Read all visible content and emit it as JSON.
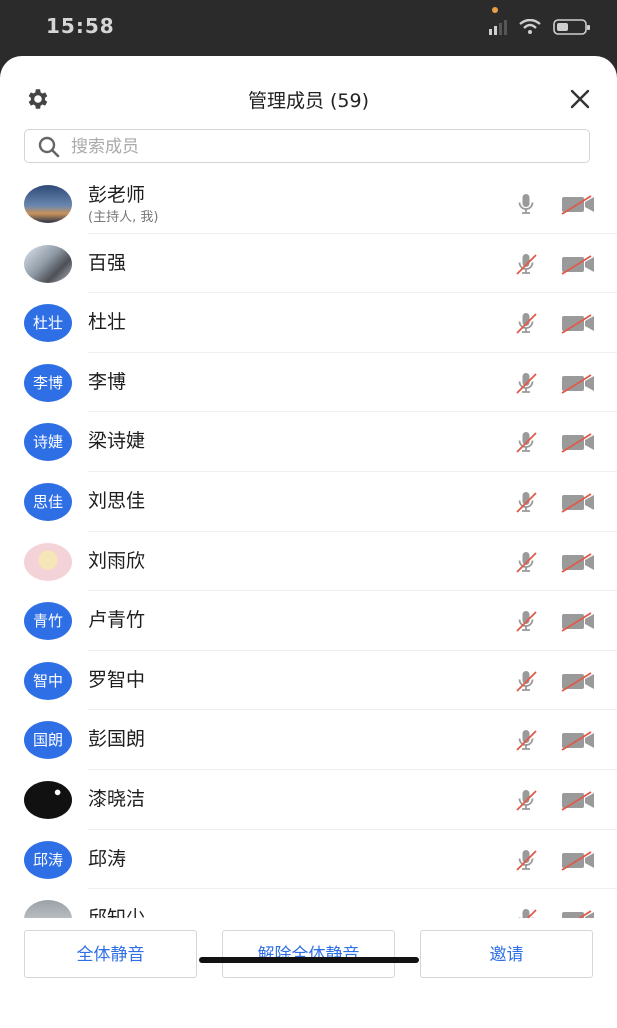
{
  "status_bar": {
    "time": "15:58"
  },
  "header": {
    "title": "管理成员 (59)",
    "settings_icon": "gear-icon",
    "close_icon": "close-icon"
  },
  "search": {
    "placeholder": "搜索成员",
    "value": ""
  },
  "members": [
    {
      "name": "彭老师",
      "subtitle": "(主持人, 我)",
      "avatar_type": "photo1",
      "avatar_text": "",
      "mic": "on",
      "cam": "off"
    },
    {
      "name": "百强",
      "subtitle": "",
      "avatar_type": "photo2",
      "avatar_text": "",
      "mic": "off",
      "cam": "off"
    },
    {
      "name": "杜壮",
      "subtitle": "",
      "avatar_type": "text",
      "avatar_text": "杜壮",
      "mic": "off",
      "cam": "off"
    },
    {
      "name": "李博",
      "subtitle": "",
      "avatar_type": "text",
      "avatar_text": "李博",
      "mic": "off",
      "cam": "off"
    },
    {
      "name": "梁诗婕",
      "subtitle": "",
      "avatar_type": "text",
      "avatar_text": "诗婕",
      "mic": "off",
      "cam": "off"
    },
    {
      "name": "刘思佳",
      "subtitle": "",
      "avatar_type": "text",
      "avatar_text": "思佳",
      "mic": "off",
      "cam": "off"
    },
    {
      "name": "刘雨欣",
      "subtitle": "",
      "avatar_type": "photo3",
      "avatar_text": "",
      "mic": "off",
      "cam": "off"
    },
    {
      "name": "卢青竹",
      "subtitle": "",
      "avatar_type": "text",
      "avatar_text": "青竹",
      "mic": "off",
      "cam": "off"
    },
    {
      "name": "罗智中",
      "subtitle": "",
      "avatar_type": "text",
      "avatar_text": "智中",
      "mic": "off",
      "cam": "off"
    },
    {
      "name": "彭国朗",
      "subtitle": "",
      "avatar_type": "text",
      "avatar_text": "国朗",
      "mic": "off",
      "cam": "off"
    },
    {
      "name": "漆晓洁",
      "subtitle": "",
      "avatar_type": "photo4",
      "avatar_text": "",
      "mic": "off",
      "cam": "off"
    },
    {
      "name": "邱涛",
      "subtitle": "",
      "avatar_type": "text",
      "avatar_text": "邱涛",
      "mic": "off",
      "cam": "off"
    },
    {
      "name": "邱知少",
      "subtitle": "",
      "avatar_type": "photo5",
      "avatar_text": "",
      "mic": "off",
      "cam": "off"
    }
  ],
  "footer": {
    "mute_all": "全体静音",
    "unmute_all": "解除全体静音",
    "invite": "邀请"
  },
  "colors": {
    "accent": "#2f6fe6",
    "muted_slash": "#e05a4a",
    "icon_gray": "#9a9a9a"
  }
}
